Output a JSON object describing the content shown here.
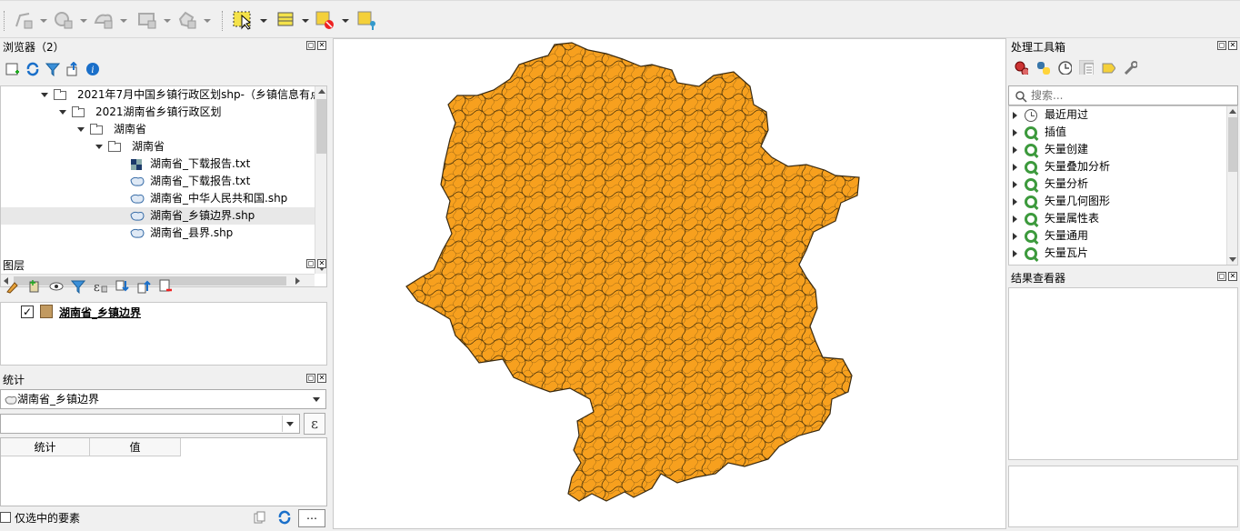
{
  "toolbar": {
    "icons": [
      "digitize-icon",
      "add-point-icon",
      "add-polygon-icon",
      "add-rect-icon",
      "add-circle-icon",
      "select-feature-icon",
      "attribute-table-icon",
      "deselect-icon",
      "identify-icon"
    ]
  },
  "browser": {
    "title": "浏览器（2）",
    "tree": [
      {
        "label": "2021年7月中国乡镇行政区划shp-（乡镇信息有点"
      },
      {
        "label": "2021湖南省乡镇行政区划"
      },
      {
        "label": "湖南省"
      },
      {
        "label": "湖南省"
      },
      {
        "label": "湖南省_下载报告.txt"
      },
      {
        "label": "湖南省_下载报告.txt"
      },
      {
        "label": "湖南省_中华人民共和国.shp"
      },
      {
        "label": "湖南省_乡镇边界.shp"
      },
      {
        "label": "湖南省_县界.shp"
      }
    ]
  },
  "layers": {
    "title": "图层",
    "items": [
      {
        "label": "湖南省_乡镇边界",
        "checked": true
      }
    ]
  },
  "stats": {
    "title": "统计",
    "layer_select": "湖南省_乡镇边界",
    "expr_btn": "ε",
    "col_stat": "统计",
    "col_value": "值",
    "only_selected": "仅选中的要素",
    "more_btn": "⋯"
  },
  "processing": {
    "title": "处理工具箱",
    "search_placeholder": "搜索...",
    "items": [
      {
        "label": "最近用过",
        "icon": "clock-icon"
      },
      {
        "label": "插值",
        "icon": "qgis-icon"
      },
      {
        "label": "矢量创建",
        "icon": "qgis-icon"
      },
      {
        "label": "矢量叠加分析",
        "icon": "qgis-icon"
      },
      {
        "label": "矢量分析",
        "icon": "qgis-icon"
      },
      {
        "label": "矢量几何图形",
        "icon": "qgis-icon"
      },
      {
        "label": "矢量属性表",
        "icon": "qgis-icon"
      },
      {
        "label": "矢量通用",
        "icon": "qgis-icon"
      },
      {
        "label": "矢量瓦片",
        "icon": "qgis-icon"
      }
    ]
  },
  "results": {
    "title": "结果查看器"
  },
  "map": {
    "fill_color": "#f7a01e",
    "stroke_color": "#3a2a10"
  }
}
